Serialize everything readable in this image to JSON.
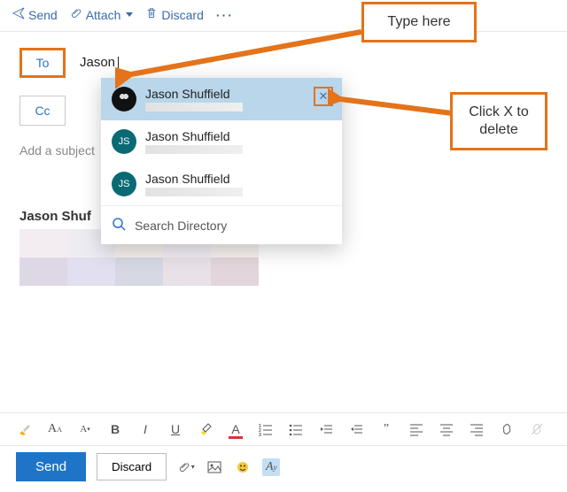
{
  "colors": {
    "accent_orange": "#e4731a",
    "link_blue": "#2b73c4",
    "send_blue": "#1e74c7"
  },
  "toolbar": {
    "send": "Send",
    "attach": "Attach",
    "discard": "Discard"
  },
  "callouts": {
    "type_here": "Type here",
    "click_x": "Click X to delete"
  },
  "compose": {
    "to_label": "To",
    "cc_label": "Cc",
    "to_value": "Jason",
    "subject_placeholder": "Add a subject",
    "greeting": "Jason Shuf"
  },
  "suggestions": {
    "items": [
      {
        "name": "Jason Shuffield",
        "initials": "",
        "avatar": "black"
      },
      {
        "name": "Jason Shuffield",
        "initials": "JS",
        "avatar": "teal"
      },
      {
        "name": "Jason Shuffield",
        "initials": "JS",
        "avatar": "teal"
      }
    ],
    "search_directory": "Search Directory",
    "delete_x": "✕"
  },
  "actions": {
    "send": "Send",
    "discard": "Discard"
  }
}
